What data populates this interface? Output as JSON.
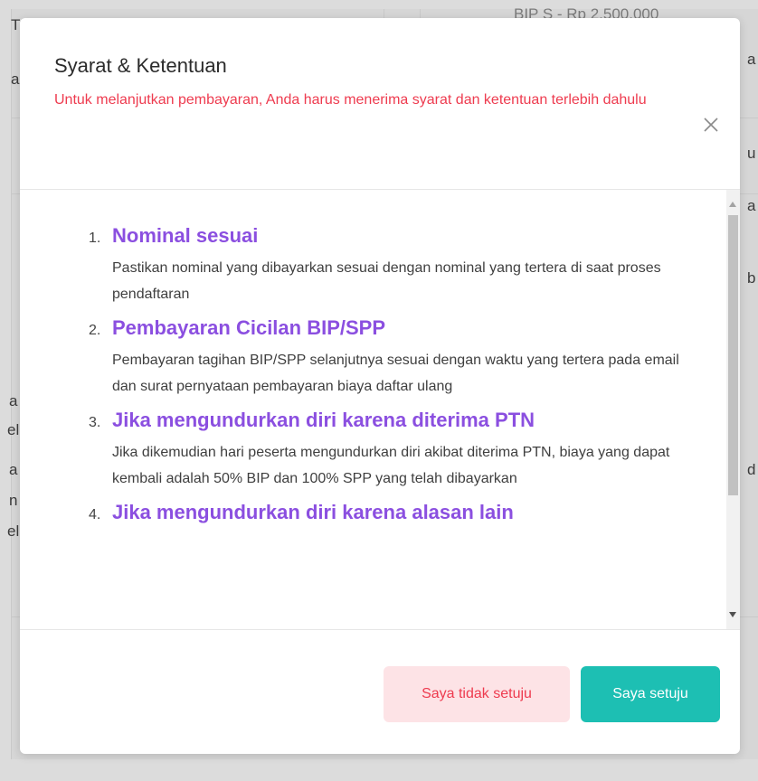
{
  "background": {
    "top_text": "BIP S  -  Rp 2.500.000",
    "left_chars": [
      "T",
      "a",
      "a",
      "el",
      "a",
      "n",
      "el"
    ],
    "right_chars": [
      "a",
      "u",
      "a",
      "b",
      "d"
    ]
  },
  "modal": {
    "title": "Syarat & Ketentuan",
    "subtitle": "Untuk melanjutkan pembayaran, Anda harus menerima syarat dan ketentuan terlebih dahulu",
    "close_icon": "close-icon",
    "terms": [
      {
        "number": "1.",
        "title": "Nominal sesuai",
        "description": "Pastikan nominal yang dibayarkan sesuai dengan nominal yang tertera di saat proses pendaftaran"
      },
      {
        "number": "2.",
        "title": "Pembayaran Cicilan BIP/SPP",
        "description": "Pembayaran tagihan BIP/SPP selanjutnya sesuai dengan waktu yang tertera pada email dan surat pernyataan pembayaran biaya daftar ulang"
      },
      {
        "number": "3.",
        "title": "Jika mengundurkan diri karena diterima PTN",
        "description": "Jika dikemudian hari peserta mengundurkan diri akibat diterima PTN, biaya yang dapat kembali adalah 50% BIP dan 100% SPP yang telah dibayarkan"
      },
      {
        "number": "4.",
        "title": "Jika mengundurkan diri karena alasan lain",
        "description": ""
      }
    ],
    "decline_label": "Saya tidak setuju",
    "agree_label": "Saya setuju"
  },
  "colors": {
    "accent_purple": "#8b4fe0",
    "warning_red": "#ee3b4f",
    "teal": "#1dbfb3",
    "decline_bg": "#fde3e6"
  }
}
